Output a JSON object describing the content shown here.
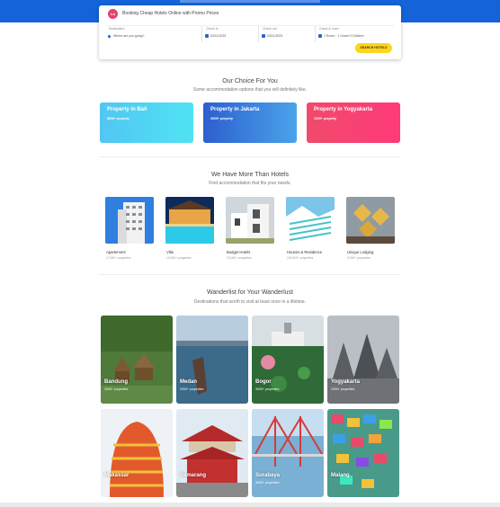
{
  "brand": {
    "logo_text": "LA"
  },
  "search": {
    "title": "Booking Cheap Hotels Online with Promo Prices",
    "destination_label": "Destination",
    "destination_placeholder": "Where are you going?",
    "checkin_label": "Check in",
    "checkin_value": "02/11/2023",
    "checkout_label": "Check out",
    "checkout_value": "03/11/2023",
    "guest_label": "Guest & room",
    "guest_value": "1 Room · 1 Guest 0 Children",
    "button_label": "SEARCH HOTELS"
  },
  "choice": {
    "title": "Our Choice For You",
    "subtitle": "Some accommodation options that you will definitely like.",
    "cards": [
      {
        "title": "Property in Bali",
        "count": "8000+ property"
      },
      {
        "title": "Property in Jakarta",
        "count": "3000+ property"
      },
      {
        "title": "Property in Yogyakarta",
        "count": "1000+ property"
      }
    ]
  },
  "types": {
    "title": "We Have More Than Hotels",
    "subtitle": "Find accommodation that fits your needs.",
    "items": [
      {
        "name": "Apartement",
        "count": "17,000+ properties"
      },
      {
        "name": "Villa",
        "count": "10,000+ properties"
      },
      {
        "name": "Budget Hotels",
        "count": "75,000+ properties"
      },
      {
        "name": "Houses & Residence",
        "count": "100,000+ properties"
      },
      {
        "name": "Unique Lodging",
        "count": "5,000+ properties"
      }
    ]
  },
  "wanderlist": {
    "title": "Wanderlist for Your Wanderlust",
    "subtitle": "Destinations that worth to visit at least once in a lifetime.",
    "items": [
      {
        "name": "Bandung",
        "count": "3000+ properties"
      },
      {
        "name": "Medan",
        "count": "2000+ properties"
      },
      {
        "name": "Bogor",
        "count": "3000+ properties"
      },
      {
        "name": "Yogyakarta",
        "count": "1000+ properties"
      },
      {
        "name": "Makassar",
        "count": ""
      },
      {
        "name": "Semarang",
        "count": ""
      },
      {
        "name": "Surabaya",
        "count": "4000+ properties"
      },
      {
        "name": "Malang",
        "count": ""
      }
    ]
  },
  "colors": {
    "primary": "#1463d8",
    "accent": "#ffd51a",
    "brand": "#e5416a"
  }
}
